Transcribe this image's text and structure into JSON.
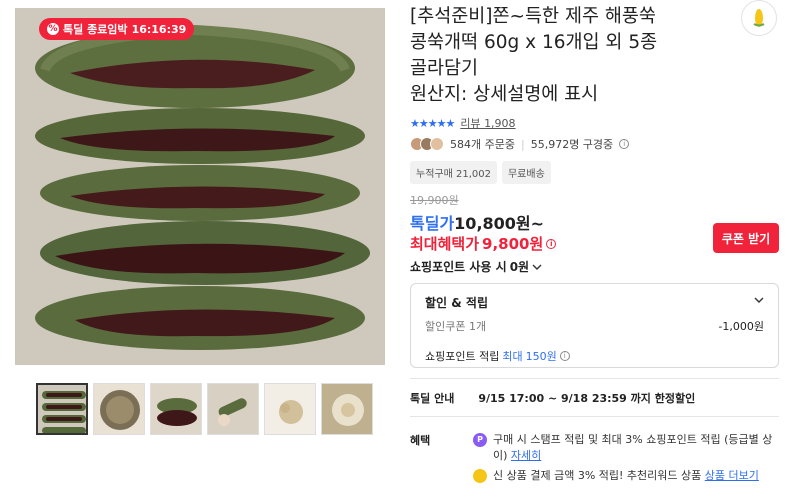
{
  "product": {
    "title_lines": [
      "[추석준비]쫀~득한 제주 해풍쑥",
      "콩쑥개떡 60g x 16개입 외 5종",
      "골라담기",
      "원산지: 상세설명에 표시"
    ]
  },
  "deal_badge": {
    "label": "톡딜 종료임박",
    "timer": "16:16:39"
  },
  "review": {
    "stars": "★★★★★",
    "label": "리뷰",
    "count": "1,908"
  },
  "orders": {
    "orders_text": "584개 주문중",
    "subscribers_text": "55,972명 구경중"
  },
  "chips": [
    "누적구매 21,002",
    "무료배송"
  ],
  "price": {
    "original": "19,900원",
    "deal_label": "톡딜가",
    "deal_value": "10,800원~",
    "max_label": "최대혜택가",
    "max_value": "9,800원"
  },
  "coupon_button": "쿠폰 받기",
  "point_use": "쇼핑포인트 사용 시",
  "point_use_value": "0원",
  "benefit_box": {
    "title": "할인 & 적립",
    "coupon_label": "할인쿠폰 1개",
    "coupon_value": "-1,000원",
    "points_label": "쇼핑포인트 적립",
    "points_prefix": "최대",
    "points_value": "150원"
  },
  "deal_info": {
    "key": "톡딜 안내",
    "value": "9/15 17:00 ~ 9/18 23:59 까지 한정할인"
  },
  "benefits": {
    "key": "혜택",
    "items": [
      {
        "text": "구매 시 스탬프 적립 및 최대 3% 쇼핑포인트 적립 (등급별 상이)",
        "link": "자세히",
        "icon": "P",
        "color": "#8a5cf5"
      },
      {
        "text": "신 상품 결제 금액 3% 적립! 추천리워드 상품",
        "link": "상품 더보기",
        "icon": "●",
        "color": "#f5c518"
      }
    ]
  },
  "colors": {
    "accent_red": "#f0233b",
    "accent_blue": "#2f6fed"
  }
}
